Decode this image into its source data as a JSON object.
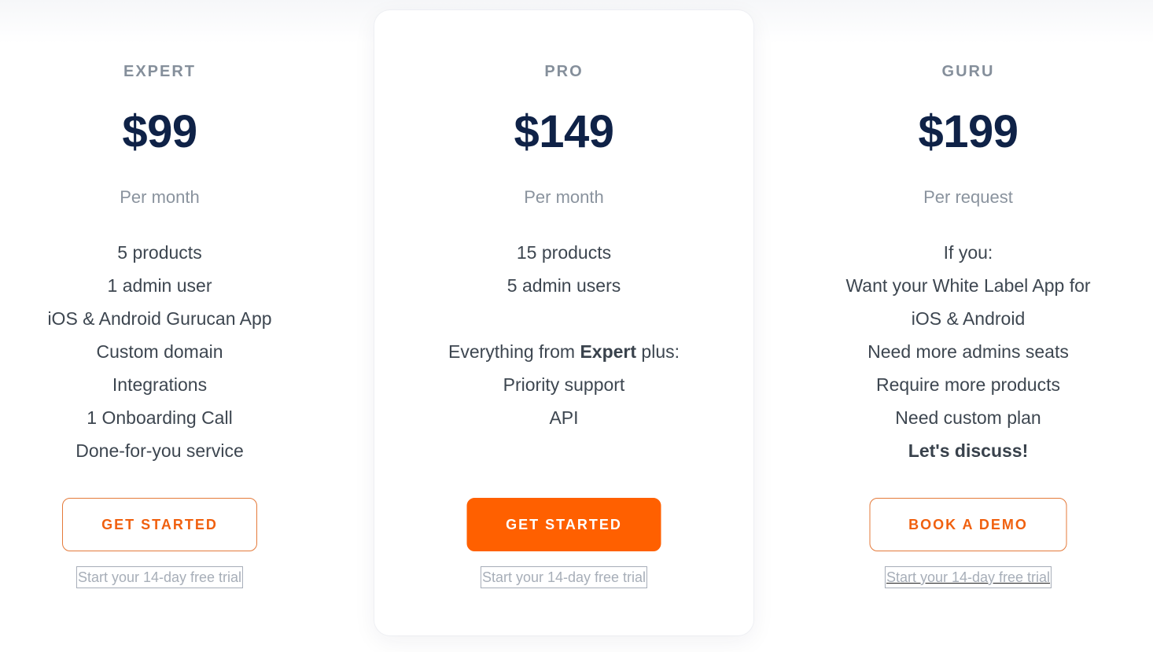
{
  "plans": [
    {
      "name": "EXPERT",
      "price": "$99",
      "period": "Per month",
      "features": [
        "5 products",
        "1 admin user",
        "iOS & Android Gurucan App",
        "Custom domain",
        "Integrations",
        "1 Onboarding Call",
        "Done-for-you service"
      ],
      "cta_label": "GET STARTED",
      "trial_link": "Start your 14-day free trial"
    },
    {
      "name": "PRO",
      "price": "$149",
      "period": "Per month",
      "features": [
        "15 products",
        "5 admin users"
      ],
      "extras_prefix": "Everything from ",
      "extras_bold": "Expert",
      "extras_suffix": " plus:",
      "extras": [
        "Priority support",
        "API"
      ],
      "cta_label": "GET STARTED",
      "trial_link": "Start your 14-day free trial",
      "highlighted": true
    },
    {
      "name": "GURU",
      "price": "$199",
      "period": "Per request",
      "features": [
        "If you:",
        "Want your White Label App for",
        "iOS & Android",
        "Need more admins seats",
        "Require more products",
        "Need custom plan"
      ],
      "closing": "Let's discuss!",
      "cta_label": "BOOK A DEMO",
      "trial_link": "Start your 14-day free trial"
    }
  ],
  "colors": {
    "accent": "#ff6000",
    "price": "#0f2247",
    "muted": "#858f9b",
    "body_text": "#3d4650"
  }
}
